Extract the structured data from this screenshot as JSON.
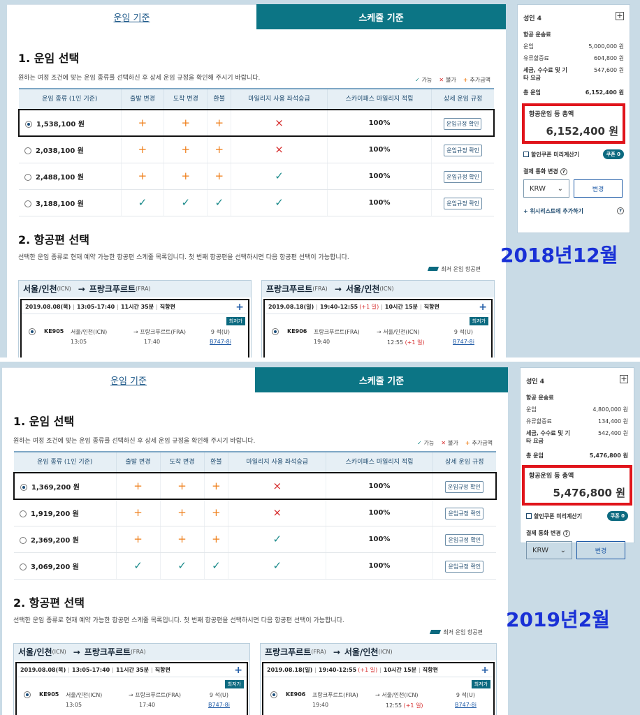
{
  "snapshots": [
    {
      "tab_fare": "운임 기준",
      "tab_schedule": "스케줄 기준",
      "sec1_title": "1. 운임 선택",
      "sec1_desc": "원하는 여정 조건에 맞는 운임 종류를 선택하신 후 상세 운임 규정을 확인해 주시기 바랍니다.",
      "legend_possible": "가능",
      "legend_impossible": "불가",
      "legend_extra": "추가금액",
      "headers": [
        "운임 종류 (1인 기준)",
        "출발 변경",
        "도착 변경",
        "환불",
        "마일리지 사용 좌석승급",
        "스카이패스 마일리지 적립",
        "상세 운임 규정"
      ],
      "rule_btn": "운임규정 확인",
      "fares": [
        {
          "price": "1,538,100 원",
          "dep": "+",
          "arr": "+",
          "refund": "+",
          "upgrade": "×",
          "miles": "100%"
        },
        {
          "price": "2,038,100 원",
          "dep": "+",
          "arr": "+",
          "refund": "+",
          "upgrade": "×",
          "miles": "100%"
        },
        {
          "price": "2,488,100 원",
          "dep": "+",
          "arr": "+",
          "refund": "+",
          "upgrade": "✓",
          "miles": "100%"
        },
        {
          "price": "3,188,100 원",
          "dep": "✓",
          "arr": "✓",
          "refund": "✓",
          "upgrade": "✓",
          "miles": "100%"
        }
      ],
      "sec2_title": "2. 항공편 선택",
      "sec2_desc": "선택한 운임 종류로 현재 예약 가능한 항공편 스케줄 목록입니다. 첫 번째 항공편을 선택하시면 다음 항공편 선택이 가능합니다.",
      "lowest_legend": "최저 운임 항공편",
      "out": {
        "from": "서울/인천",
        "from_code": "(ICN)",
        "to": "프랑크푸르트",
        "to_code": "(FRA)",
        "date": "2019.08.08(목)",
        "time": "13:05-17:40",
        "duration": "11시간 35분",
        "type": "직항편",
        "lowest": "최저가",
        "flight_no": "KE905",
        "dep_city": "서울/인천(ICN)",
        "dep_time": "13:05",
        "arr_city": "프랑크푸르트(FRA)",
        "arr_time": "17:40",
        "arr_next": "",
        "seats": "9 석(U)",
        "aircraft": "B747-8i"
      },
      "ret": {
        "from": "프랑크푸르트",
        "from_code": "(FRA)",
        "to": "서울/인천",
        "to_code": "(ICN)",
        "date": "2019.08.18(일)",
        "time": "19:40-12:55",
        "next_day": "(+1 일)",
        "duration": "10시간 15분",
        "type": "직항편",
        "lowest": "최저가",
        "flight_no": "KE906",
        "dep_city": "프랑크푸르트(FRA)",
        "dep_time": "19:40",
        "arr_city": "서울/인천(ICN)",
        "arr_time": "12:55",
        "arr_next": "(+1 일)",
        "seats": "9 석(U)",
        "aircraft": "B747-8i"
      },
      "side": {
        "adult": "성인 4",
        "fare_label": "항공 운송료",
        "fare": "운임",
        "fare_val": "5,000,000 원",
        "fuel": "유류할증료",
        "fuel_val": "604,800 원",
        "tax": "세금, 수수료 및 기타 요금",
        "tax_val": "547,600 원",
        "total_label": "총 운임",
        "total_val": "6,152,400 원",
        "grand_label": "항공운임 등 총액",
        "grand_val": "6,152,400 원",
        "coupon_label": "할인쿠폰 미리계산기",
        "coupon_badge": "쿠폰 0",
        "currency_label": "결제 통화 변경",
        "currency": "KRW",
        "change_btn": "변경",
        "wishlist": "+ 위시리스트에 추가하기"
      },
      "stamp": "2018년12월"
    },
    {
      "tab_fare": "운임 기준",
      "tab_schedule": "스케줄 기준",
      "sec1_title": "1. 운임 선택",
      "sec1_desc": "원하는 여정 조건에 맞는 운임 종류를 선택하신 후 상세 운임 규정을 확인해 주시기 바랍니다.",
      "legend_possible": "가능",
      "legend_impossible": "불가",
      "legend_extra": "추가금액",
      "headers": [
        "운임 종류 (1인 기준)",
        "출발 변경",
        "도착 변경",
        "환불",
        "마일리지 사용 좌석승급",
        "스카이패스 마일리지 적립",
        "상세 운임 규정"
      ],
      "rule_btn": "운임규정 확인",
      "fares": [
        {
          "price": "1,369,200 원",
          "dep": "+",
          "arr": "+",
          "refund": "+",
          "upgrade": "×",
          "miles": "100%"
        },
        {
          "price": "1,919,200 원",
          "dep": "+",
          "arr": "+",
          "refund": "+",
          "upgrade": "×",
          "miles": "100%"
        },
        {
          "price": "2,369,200 원",
          "dep": "+",
          "arr": "+",
          "refund": "+",
          "upgrade": "✓",
          "miles": "100%"
        },
        {
          "price": "3,069,200 원",
          "dep": "✓",
          "arr": "✓",
          "refund": "✓",
          "upgrade": "✓",
          "miles": "100%"
        }
      ],
      "sec2_title": "2. 항공편 선택",
      "sec2_desc": "선택한 운임 종류로 현재 예약 가능한 항공편 스케줄 목록입니다. 첫 번째 항공편을 선택하시면 다음 항공편 선택이 가능합니다.",
      "lowest_legend": "최저 운임 항공편",
      "out": {
        "from": "서울/인천",
        "from_code": "(ICN)",
        "to": "프랑크푸르트",
        "to_code": "(FRA)",
        "date": "2019.08.08(목)",
        "time": "13:05-17:40",
        "duration": "11시간 35분",
        "type": "직항편",
        "lowest": "최저가",
        "flight_no": "KE905",
        "dep_city": "서울/인천(ICN)",
        "dep_time": "13:05",
        "arr_city": "프랑크푸르트(FRA)",
        "arr_time": "17:40",
        "arr_next": "",
        "seats": "9 석(U)",
        "aircraft": "B747-8i"
      },
      "ret": {
        "from": "프랑크푸르트",
        "from_code": "(FRA)",
        "to": "서울/인천",
        "to_code": "(ICN)",
        "date": "2019.08.18(일)",
        "time": "19:40-12:55",
        "next_day": "(+1 일)",
        "duration": "10시간 15분",
        "type": "직항편",
        "lowest": "최저가",
        "flight_no": "KE906",
        "dep_city": "프랑크푸르트(FRA)",
        "dep_time": "19:40",
        "arr_city": "서울/인천(ICN)",
        "arr_time": "12:55",
        "arr_next": "(+1 일)",
        "seats": "9 석(U)",
        "aircraft": "B747-8i"
      },
      "side": {
        "adult": "성인 4",
        "fare_label": "항공 운송료",
        "fare": "운임",
        "fare_val": "4,800,000 원",
        "fuel": "유류할증료",
        "fuel_val": "134,400 원",
        "tax": "세금, 수수료 및 기타 요금",
        "tax_val": "542,400 원",
        "total_label": "총 운임",
        "total_val": "5,476,800 원",
        "grand_label": "항공운임 등 총액",
        "grand_val": "5,476,800 원",
        "coupon_label": "할인쿠폰 미리계산기",
        "coupon_badge": "쿠폰 0",
        "currency_label": "결제 통화 변경",
        "currency": "KRW",
        "change_btn": "변경",
        "wishlist": ""
      },
      "stamp": "2019년2월"
    }
  ],
  "colors": {
    "teal": "#0c7585",
    "red_box": "#e0141b",
    "stamp_blue": "#1930d6",
    "check": "#1a8a8a",
    "x": "#d62a2a",
    "plus": "#ef7f1a"
  },
  "icons": {
    "check": "check-icon",
    "x": "x-icon",
    "plus": "plus-icon"
  }
}
